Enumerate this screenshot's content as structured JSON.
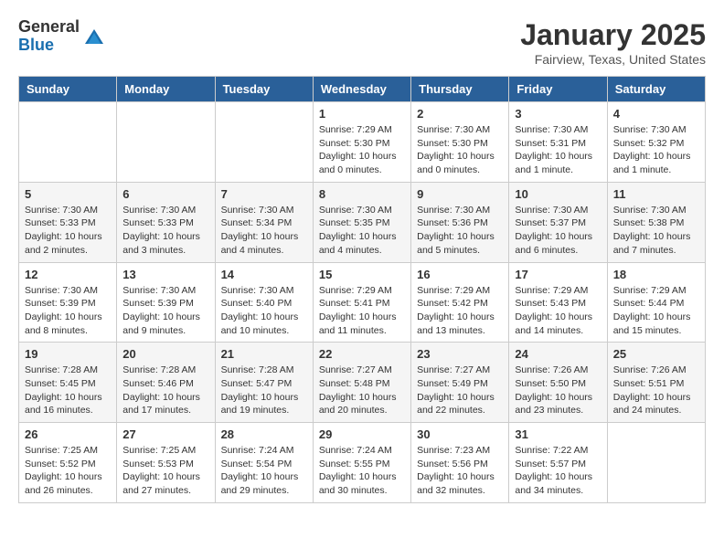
{
  "logo": {
    "general": "General",
    "blue": "Blue"
  },
  "title": "January 2025",
  "subtitle": "Fairview, Texas, United States",
  "weekdays": [
    "Sunday",
    "Monday",
    "Tuesday",
    "Wednesday",
    "Thursday",
    "Friday",
    "Saturday"
  ],
  "rows": [
    {
      "alt": false,
      "cells": [
        {
          "day": "",
          "info": ""
        },
        {
          "day": "",
          "info": ""
        },
        {
          "day": "",
          "info": ""
        },
        {
          "day": "1",
          "info": "Sunrise: 7:29 AM\nSunset: 5:30 PM\nDaylight: 10 hours\nand 0 minutes."
        },
        {
          "day": "2",
          "info": "Sunrise: 7:30 AM\nSunset: 5:30 PM\nDaylight: 10 hours\nand 0 minutes."
        },
        {
          "day": "3",
          "info": "Sunrise: 7:30 AM\nSunset: 5:31 PM\nDaylight: 10 hours\nand 1 minute."
        },
        {
          "day": "4",
          "info": "Sunrise: 7:30 AM\nSunset: 5:32 PM\nDaylight: 10 hours\nand 1 minute."
        }
      ]
    },
    {
      "alt": true,
      "cells": [
        {
          "day": "5",
          "info": "Sunrise: 7:30 AM\nSunset: 5:33 PM\nDaylight: 10 hours\nand 2 minutes."
        },
        {
          "day": "6",
          "info": "Sunrise: 7:30 AM\nSunset: 5:33 PM\nDaylight: 10 hours\nand 3 minutes."
        },
        {
          "day": "7",
          "info": "Sunrise: 7:30 AM\nSunset: 5:34 PM\nDaylight: 10 hours\nand 4 minutes."
        },
        {
          "day": "8",
          "info": "Sunrise: 7:30 AM\nSunset: 5:35 PM\nDaylight: 10 hours\nand 4 minutes."
        },
        {
          "day": "9",
          "info": "Sunrise: 7:30 AM\nSunset: 5:36 PM\nDaylight: 10 hours\nand 5 minutes."
        },
        {
          "day": "10",
          "info": "Sunrise: 7:30 AM\nSunset: 5:37 PM\nDaylight: 10 hours\nand 6 minutes."
        },
        {
          "day": "11",
          "info": "Sunrise: 7:30 AM\nSunset: 5:38 PM\nDaylight: 10 hours\nand 7 minutes."
        }
      ]
    },
    {
      "alt": false,
      "cells": [
        {
          "day": "12",
          "info": "Sunrise: 7:30 AM\nSunset: 5:39 PM\nDaylight: 10 hours\nand 8 minutes."
        },
        {
          "day": "13",
          "info": "Sunrise: 7:30 AM\nSunset: 5:39 PM\nDaylight: 10 hours\nand 9 minutes."
        },
        {
          "day": "14",
          "info": "Sunrise: 7:30 AM\nSunset: 5:40 PM\nDaylight: 10 hours\nand 10 minutes."
        },
        {
          "day": "15",
          "info": "Sunrise: 7:29 AM\nSunset: 5:41 PM\nDaylight: 10 hours\nand 11 minutes."
        },
        {
          "day": "16",
          "info": "Sunrise: 7:29 AM\nSunset: 5:42 PM\nDaylight: 10 hours\nand 13 minutes."
        },
        {
          "day": "17",
          "info": "Sunrise: 7:29 AM\nSunset: 5:43 PM\nDaylight: 10 hours\nand 14 minutes."
        },
        {
          "day": "18",
          "info": "Sunrise: 7:29 AM\nSunset: 5:44 PM\nDaylight: 10 hours\nand 15 minutes."
        }
      ]
    },
    {
      "alt": true,
      "cells": [
        {
          "day": "19",
          "info": "Sunrise: 7:28 AM\nSunset: 5:45 PM\nDaylight: 10 hours\nand 16 minutes."
        },
        {
          "day": "20",
          "info": "Sunrise: 7:28 AM\nSunset: 5:46 PM\nDaylight: 10 hours\nand 17 minutes."
        },
        {
          "day": "21",
          "info": "Sunrise: 7:28 AM\nSunset: 5:47 PM\nDaylight: 10 hours\nand 19 minutes."
        },
        {
          "day": "22",
          "info": "Sunrise: 7:27 AM\nSunset: 5:48 PM\nDaylight: 10 hours\nand 20 minutes."
        },
        {
          "day": "23",
          "info": "Sunrise: 7:27 AM\nSunset: 5:49 PM\nDaylight: 10 hours\nand 22 minutes."
        },
        {
          "day": "24",
          "info": "Sunrise: 7:26 AM\nSunset: 5:50 PM\nDaylight: 10 hours\nand 23 minutes."
        },
        {
          "day": "25",
          "info": "Sunrise: 7:26 AM\nSunset: 5:51 PM\nDaylight: 10 hours\nand 24 minutes."
        }
      ]
    },
    {
      "alt": false,
      "cells": [
        {
          "day": "26",
          "info": "Sunrise: 7:25 AM\nSunset: 5:52 PM\nDaylight: 10 hours\nand 26 minutes."
        },
        {
          "day": "27",
          "info": "Sunrise: 7:25 AM\nSunset: 5:53 PM\nDaylight: 10 hours\nand 27 minutes."
        },
        {
          "day": "28",
          "info": "Sunrise: 7:24 AM\nSunset: 5:54 PM\nDaylight: 10 hours\nand 29 minutes."
        },
        {
          "day": "29",
          "info": "Sunrise: 7:24 AM\nSunset: 5:55 PM\nDaylight: 10 hours\nand 30 minutes."
        },
        {
          "day": "30",
          "info": "Sunrise: 7:23 AM\nSunset: 5:56 PM\nDaylight: 10 hours\nand 32 minutes."
        },
        {
          "day": "31",
          "info": "Sunrise: 7:22 AM\nSunset: 5:57 PM\nDaylight: 10 hours\nand 34 minutes."
        },
        {
          "day": "",
          "info": ""
        }
      ]
    }
  ]
}
